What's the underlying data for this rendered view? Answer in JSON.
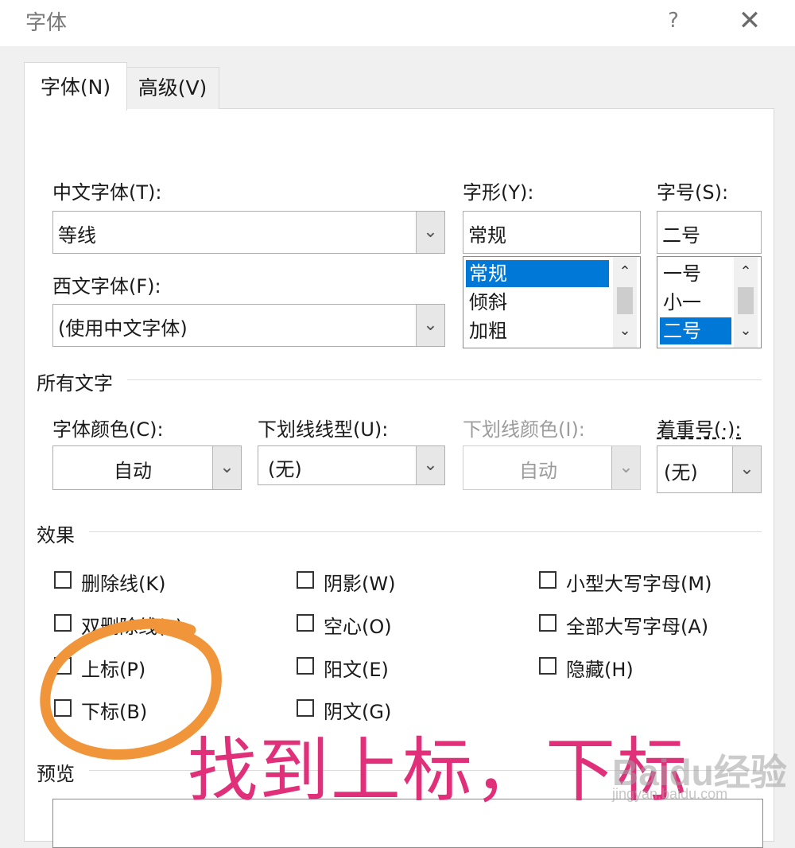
{
  "window": {
    "title": "字体",
    "help": "?",
    "close": "✕"
  },
  "tabs": [
    {
      "label": "字体(N)"
    },
    {
      "label": "高级(V)"
    }
  ],
  "chinese_font": {
    "label": "中文字体(T):",
    "value": "等线"
  },
  "western_font": {
    "label": "西文字体(F):",
    "value": "(使用中文字体)"
  },
  "style": {
    "label": "字形(Y):",
    "value": "常规",
    "options": [
      "常规",
      "倾斜",
      "加粗"
    ],
    "selected": "常规"
  },
  "size": {
    "label": "字号(S):",
    "value": "二号",
    "options": [
      "一号",
      "小一",
      "二号"
    ],
    "selected": "二号"
  },
  "all_text": {
    "title": "所有文字",
    "font_color": {
      "label": "字体颜色(C):",
      "value": "自动"
    },
    "underline_style": {
      "label": "下划线线型(U):",
      "value": "(无)"
    },
    "underline_color": {
      "label": "下划线颜色(I):",
      "value": "自动"
    },
    "emphasis": {
      "label": "着重号(·):",
      "value": "(无)"
    }
  },
  "effects": {
    "title": "效果",
    "col1": [
      "删除线(K)",
      "双删除线(L)",
      "上标(P)",
      "下标(B)"
    ],
    "col2": [
      "阴影(W)",
      "空心(O)",
      "阳文(E)",
      "阴文(G)"
    ],
    "col3": [
      "小型大写字母(M)",
      "全部大写字母(A)",
      "隐藏(H)"
    ]
  },
  "preview": {
    "title": "预览"
  },
  "annotation": {
    "text": "找到上标，下标",
    "color": "#e0307a",
    "circle_color": "#f0953a"
  },
  "watermark": {
    "brand": "Baidu经验",
    "url": "jingyan.baidu.com"
  },
  "colors": {
    "selection": "#0078d7",
    "panel": "#ffffff",
    "background": "#f0f0f0"
  }
}
